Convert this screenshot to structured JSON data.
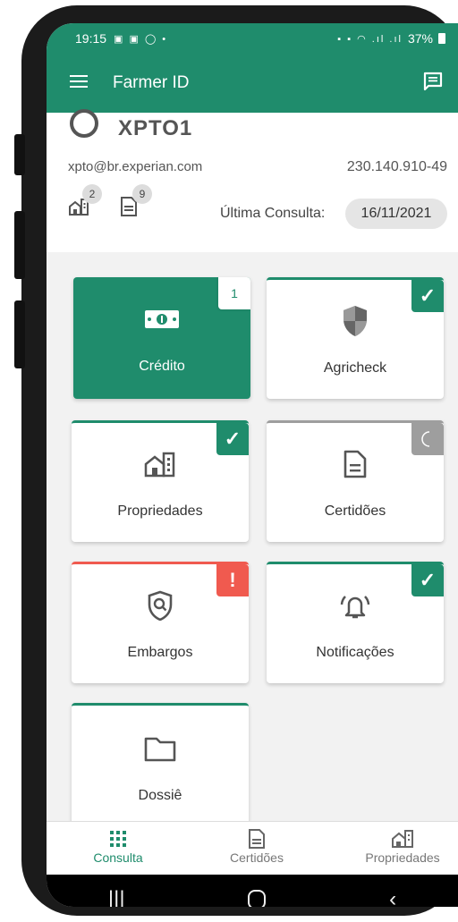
{
  "status_bar": {
    "time": "19:15",
    "battery": "37%"
  },
  "app_bar": {
    "title": "Farmer ID"
  },
  "profile": {
    "name": "XPTO1",
    "email": "xpto@br.experian.com",
    "document": "230.140.910-49",
    "properties_count": "2",
    "certificates_count": "9",
    "last_query_label": "Última Consulta:",
    "last_query_date": "16/11/2021"
  },
  "cards": [
    {
      "label": "Crédito",
      "badge": "1",
      "status": "count",
      "icon": "money-icon"
    },
    {
      "label": "Agricheck",
      "status": "ok",
      "icon": "shield-icon"
    },
    {
      "label": "Propriedades",
      "status": "ok",
      "icon": "building-icon"
    },
    {
      "label": "Certidões",
      "status": "loading",
      "icon": "document-icon"
    },
    {
      "label": "Embargos",
      "status": "alert",
      "icon": "shield-search-icon"
    },
    {
      "label": "Notificações",
      "status": "ok",
      "icon": "bell-icon"
    },
    {
      "label": "Dossiê",
      "status": "ok",
      "icon": "folder-icon"
    }
  ],
  "bottom_nav": {
    "items": [
      {
        "label": "Consulta",
        "icon": "grid-icon",
        "selected": true
      },
      {
        "label": "Certidões",
        "icon": "document-icon",
        "selected": false
      },
      {
        "label": "Propriedades",
        "icon": "building-icon",
        "selected": false
      }
    ]
  },
  "colors": {
    "primary": "#1f8c6c",
    "alert": "#f05a4f",
    "pending": "#9e9e9e"
  }
}
